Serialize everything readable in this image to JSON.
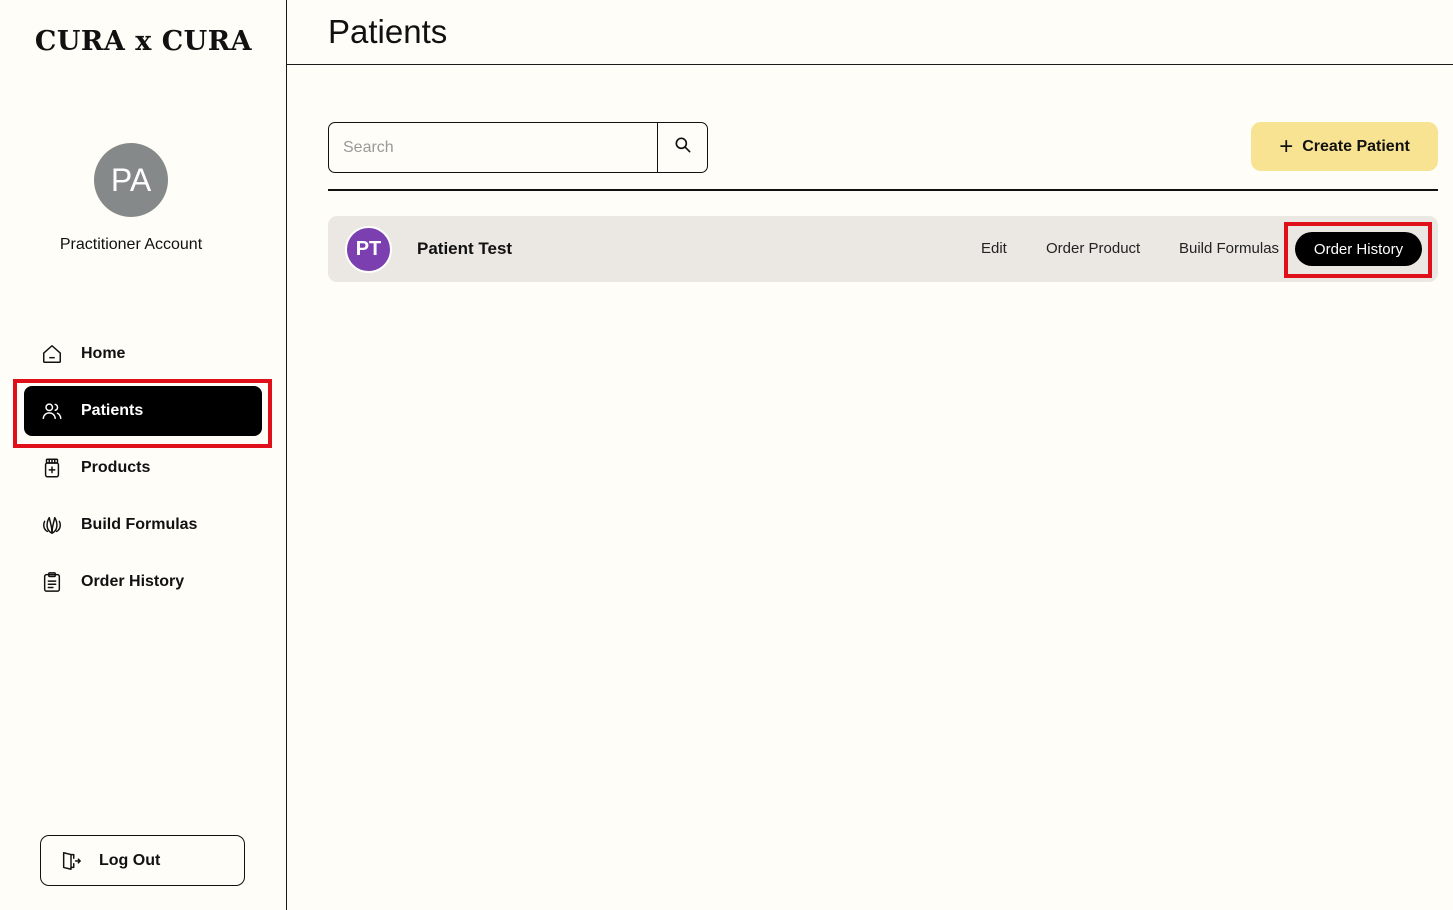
{
  "brand": {
    "logo_text": "CURA x CURA"
  },
  "account": {
    "initials": "PA",
    "name": "Practitioner Account",
    "avatar_color": "#86898a"
  },
  "nav": {
    "items": [
      {
        "label": "Home",
        "icon": "home-icon"
      },
      {
        "label": "Patients",
        "icon": "users-icon",
        "active": true
      },
      {
        "label": "Products",
        "icon": "bottle-icon"
      },
      {
        "label": "Build Formulas",
        "icon": "leaf-icon"
      },
      {
        "label": "Order History",
        "icon": "clipboard-icon"
      }
    ],
    "logout_label": "Log Out"
  },
  "page": {
    "title": "Patients"
  },
  "search": {
    "placeholder": "Search",
    "value": ""
  },
  "create_button": {
    "label": "Create Patient",
    "color": "#f8e392"
  },
  "patients": [
    {
      "initials": "PT",
      "name": "Patient Test",
      "avatar_color": "#7b3fb0",
      "actions": {
        "edit": "Edit",
        "order_product": "Order Product",
        "build_formulas": "Build Formulas",
        "order_history": "Order History"
      }
    }
  ],
  "colors": {
    "highlight": "#e0101a",
    "background": "#fffdf7",
    "row_bg": "#ebe8e4"
  }
}
